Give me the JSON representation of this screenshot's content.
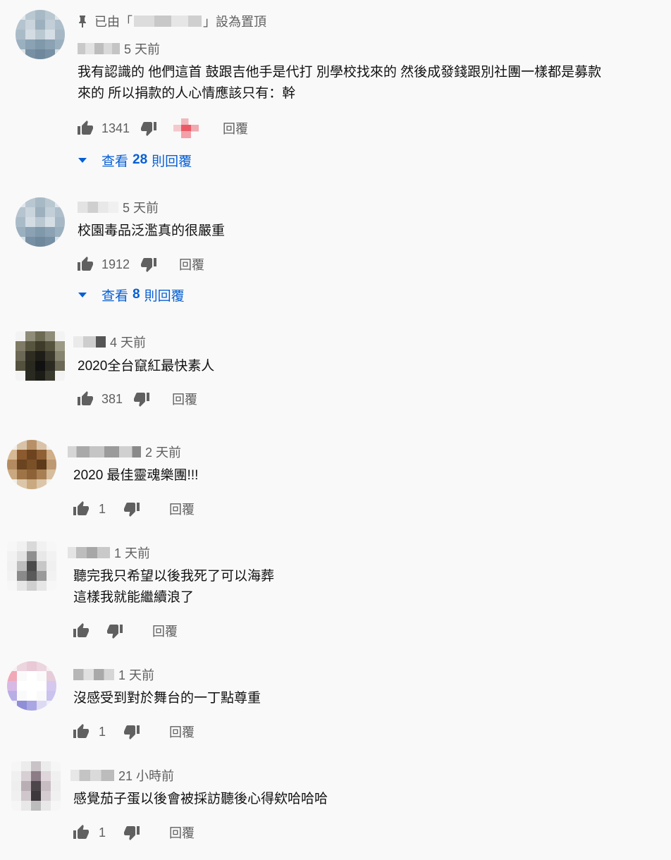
{
  "pinned": {
    "prefix": "已由「",
    "suffix": "」設為置頂"
  },
  "ui": {
    "reply_label": "回覆",
    "view_prefix": "查看",
    "view_suffix": "則回覆"
  },
  "comments": [
    {
      "time": "5 天前",
      "lines": [
        "我有認識的 他們這首 鼓跟吉他手是代打 別學校找來的 然後成發錢跟別社團一樣都是募款",
        "來的 所以捐款的人心情應該只有：幹"
      ],
      "likes": "1341",
      "replies_count": "28"
    },
    {
      "time": "5 天前",
      "lines": [
        "校園毒品泛濫真的很嚴重"
      ],
      "likes": "1912",
      "replies_count": "8"
    },
    {
      "time": "4 天前",
      "lines": [
        "2020全台竄紅最快素人"
      ],
      "likes": "381"
    },
    {
      "time": "2 天前",
      "lines": [
        "2020 最佳靈魂樂團!!!"
      ],
      "likes": "1"
    },
    {
      "time": "1 天前",
      "lines": [
        "聽完我只希望以後我死了可以海葬",
        "這樣我就能繼續浪了"
      ],
      "likes": ""
    },
    {
      "time": "1 天前",
      "lines": [
        "沒感受到對於舞台的一丁點尊重"
      ],
      "likes": "1"
    },
    {
      "time": "21 小時前",
      "lines": [
        "感覺茄子蛋以後會被採訪聽後心得欸哈哈哈"
      ],
      "likes": "1"
    }
  ],
  "colors": {
    "link": "#065fd4",
    "meta": "#606060",
    "background": "#f9f9f9"
  }
}
